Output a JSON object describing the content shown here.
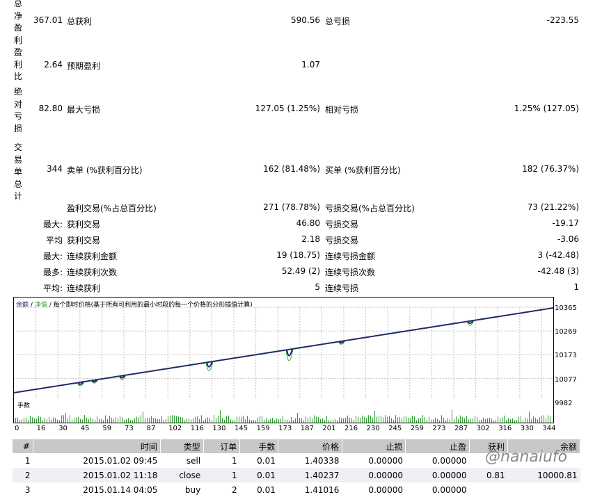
{
  "summary": {
    "net": {
      "label": "总净盈利",
      "value": "367.01",
      "l2": "总获利",
      "v2": "590.56",
      "l3": "总亏损",
      "v3": "-223.55"
    },
    "pf": {
      "label": "盈利比",
      "value": "2.64",
      "l2": "预期盈利",
      "v2": "1.07"
    },
    "dd": {
      "label": "绝对亏损",
      "value": "82.80",
      "l2": "最大亏损",
      "v2": "127.05 (1.25%)",
      "l3": "相对亏损",
      "v3": "1.25% (127.05)"
    },
    "trades": {
      "label": "交易单总计",
      "value": "344",
      "l2": "卖单 (%获利百分比)",
      "v2": "162 (81.48%)",
      "l3": "买单 (%获利百分比)",
      "v3": "182 (76.37%)"
    }
  },
  "rows": [
    {
      "p": "",
      "l2": "盈利交易(%占总百分比)",
      "v2": "271 (78.78%)",
      "l3": "亏损交易(%占总百分比)",
      "v3": "73 (21.22%)"
    },
    {
      "p": "最大:",
      "l2": "获利交易",
      "v2": "46.80",
      "l3": "亏损交易",
      "v3": "-19.17"
    },
    {
      "p": "平均",
      "l2": "获利交易",
      "v2": "2.18",
      "l3": "亏损交易",
      "v3": "-3.06"
    },
    {
      "p": "最大:",
      "l2": "连续获利金额",
      "v2": "19 (18.75)",
      "l3": "连续亏损金额",
      "v3": "3 (-42.48)"
    },
    {
      "p": "最多:",
      "l2": "连续获利次数",
      "v2": "52.49 (2)",
      "l3": "连续亏损次数",
      "v3": "-42.48 (3)"
    },
    {
      "p": "平均:",
      "l2": "连续获利",
      "v2": "5",
      "l3": "连续亏损",
      "v3": "1"
    }
  ],
  "chart_legend": {
    "balance": "余额",
    "sep1": "/",
    "equity": "净值",
    "sep2": "/",
    "desc": "每个即时价格(基于所有可利用的最小时段的每一个价格的分形插值计算)"
  },
  "chart_data": {
    "type": "line",
    "series": [
      {
        "name": "余额",
        "color": "#1f2a6b"
      },
      {
        "name": "净值",
        "color": "#2e9e2e"
      }
    ],
    "y_ticks": [
      "10365",
      "10269",
      "10173",
      "10077",
      "9982"
    ],
    "x_ticks": [
      "0",
      "16",
      "30",
      "45",
      "59",
      "73",
      "87",
      "102",
      "116",
      "130",
      "145",
      "159",
      "173",
      "187",
      "201",
      "216",
      "230",
      "245",
      "259",
      "273",
      "287",
      "302",
      "316",
      "330",
      "344"
    ],
    "ylim": [
      9982,
      10365
    ],
    "lots_label": "手数"
  },
  "table": {
    "headers": [
      "#",
      "时间",
      "类型",
      "订单",
      "手数",
      "价格",
      "止损",
      "止盈",
      "获利",
      "余额"
    ],
    "rows": [
      [
        "1",
        "2015.01.02 09:45",
        "sell",
        "1",
        "0.01",
        "1.40338",
        "0.00000",
        "0.00000",
        "",
        ""
      ],
      [
        "2",
        "2015.01.02 11:18",
        "close",
        "1",
        "0.01",
        "1.40237",
        "0.00000",
        "0.00000",
        "0.81",
        "10000.81"
      ],
      [
        "3",
        "2015.01.14 04:05",
        "buy",
        "2",
        "0.01",
        "1.41016",
        "0.00000",
        "0.00000",
        "",
        ""
      ]
    ]
  },
  "watermark": "@nanaiufo"
}
